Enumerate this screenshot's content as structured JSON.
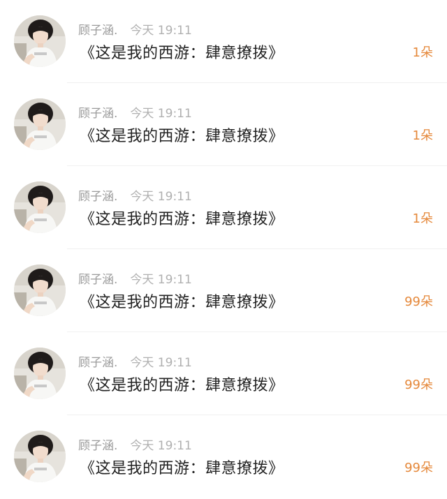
{
  "colors": {
    "count": "#e5883a",
    "meta": "#9a9a9a",
    "title": "#222222"
  },
  "items": [
    {
      "avatar_icon": "user-photo-avatar",
      "author": "顾子涵.",
      "time": "今天 19:11",
      "title": "《这是我的西游：肆意撩拨》",
      "count": "1朵"
    },
    {
      "avatar_icon": "user-photo-avatar",
      "author": "顾子涵.",
      "time": "今天 19:11",
      "title": "《这是我的西游：肆意撩拨》",
      "count": "1朵"
    },
    {
      "avatar_icon": "user-photo-avatar",
      "author": "顾子涵.",
      "time": "今天 19:11",
      "title": "《这是我的西游：肆意撩拨》",
      "count": "1朵"
    },
    {
      "avatar_icon": "user-photo-avatar",
      "author": "顾子涵.",
      "time": "今天 19:11",
      "title": "《这是我的西游：肆意撩拨》",
      "count": "99朵"
    },
    {
      "avatar_icon": "user-photo-avatar",
      "author": "顾子涵.",
      "time": "今天 19:11",
      "title": "《这是我的西游：肆意撩拨》",
      "count": "99朵"
    },
    {
      "avatar_icon": "user-photo-avatar",
      "author": "顾子涵.",
      "time": "今天 19:11",
      "title": "《这是我的西游：肆意撩拨》",
      "count": "99朵"
    }
  ]
}
